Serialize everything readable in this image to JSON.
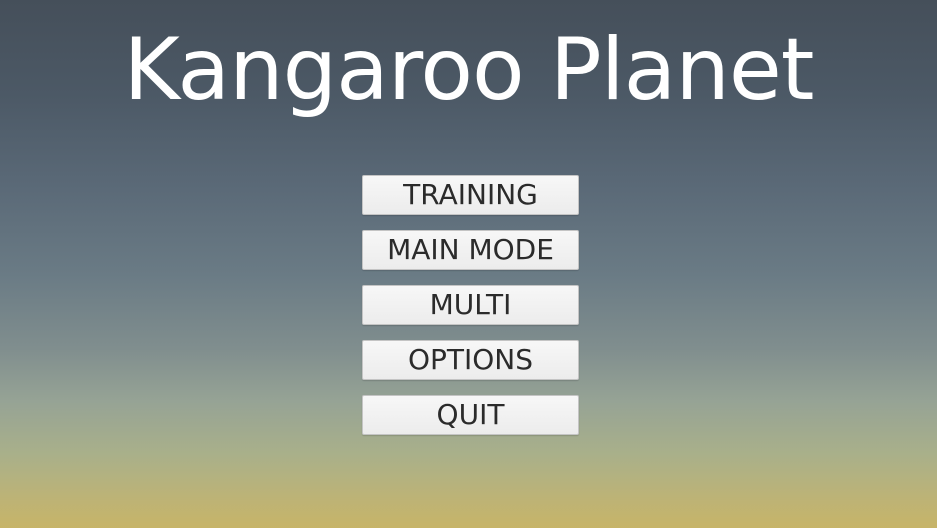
{
  "game": {
    "title": "Kangaroo Planet"
  },
  "menu": {
    "items": [
      {
        "label": "TRAINING"
      },
      {
        "label": "MAIN MODE"
      },
      {
        "label": "MULTI"
      },
      {
        "label": "OPTIONS"
      },
      {
        "label": "QUIT"
      }
    ]
  },
  "colors": {
    "sky_top": "#454f5a",
    "sky_bottom": "#c7b468",
    "title_text": "#ffffff",
    "button_bg": "#f2f2f2",
    "button_text": "#2b2b2b"
  }
}
